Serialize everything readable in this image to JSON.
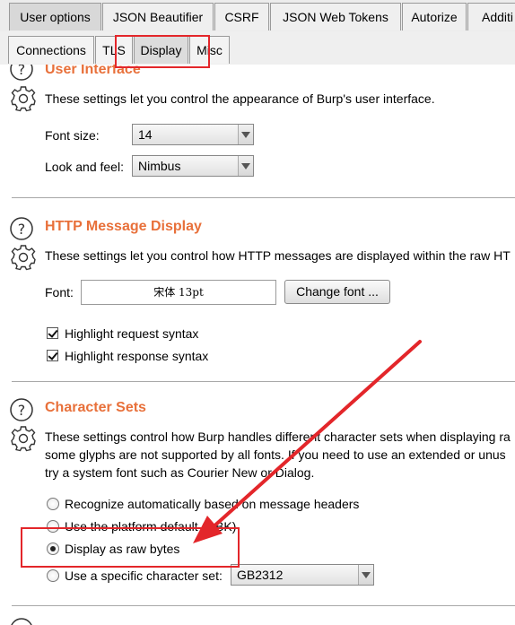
{
  "top_tabs": [
    "User options",
    "JSON Beautifier",
    "CSRF",
    "JSON Web Tokens",
    "Autorize",
    "Additi"
  ],
  "sub_tabs": [
    "Connections",
    "TLS",
    "Display",
    "Misc"
  ],
  "user_interface": {
    "title": "User Interface",
    "description": "These settings let you control the appearance of Burp's user interface.",
    "font_size_label": "Font size:",
    "font_size_value": "14",
    "look_feel_label": "Look and feel:",
    "look_feel_value": "Nimbus"
  },
  "http_display": {
    "title": "HTTP Message Display",
    "description": "These settings let you control how HTTP messages are displayed within the raw HT",
    "font_label": "Font:",
    "font_value": "宋体 13pt",
    "change_font_button": "Change font ...",
    "highlight_request": "Highlight request syntax",
    "highlight_response": "Highlight response syntax",
    "highlight_request_checked": true,
    "highlight_response_checked": true
  },
  "character_sets": {
    "title": "Character Sets",
    "description_lines": [
      "These settings control how Burp handles different character sets when displaying ra",
      "some glyphs are not supported by all fonts. If you need to use an extended or unus",
      "try a system font such as Courier New or Dialog."
    ],
    "options": [
      "Recognize automatically based on message headers",
      "Use the platform default (GBK)",
      "Display as raw bytes",
      "Use a specific character set:"
    ],
    "selected_option": "Display as raw bytes",
    "specific_charset_value": "GB2312"
  },
  "colors": {
    "accent": "#e8703a",
    "annotation": "#e3262a"
  }
}
